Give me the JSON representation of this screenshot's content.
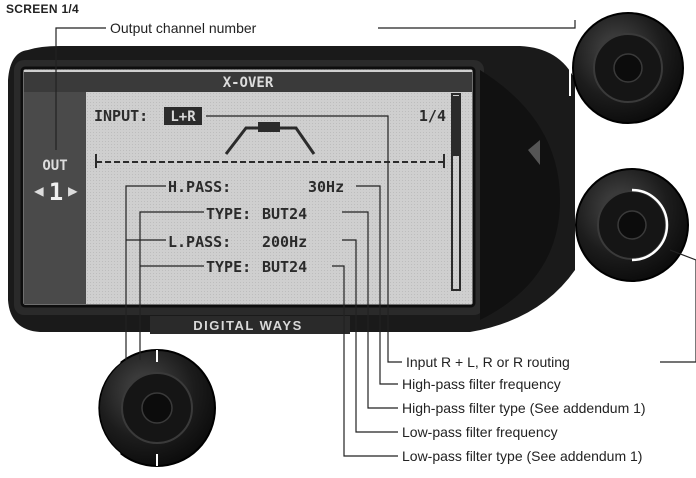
{
  "screen_label": "SCREEN 1/4",
  "lcd": {
    "title": "X-OVER",
    "input_label": "INPUT:",
    "input_value": "L+R",
    "page": "1/4",
    "out_label": "OUT",
    "channel": "1",
    "hpass_label": "H.PASS:",
    "hpass_value": "30Hz",
    "hpass_type_label": "TYPE:",
    "hpass_type_value": "BUT24",
    "lpass_label": "L.PASS:",
    "lpass_value": "200Hz",
    "lpass_type_label": "TYPE:",
    "lpass_type_value": "BUT24"
  },
  "brand": "DIGITAL WAYS",
  "callouts": {
    "output_channel": "Output channel number",
    "input_routing": "Input R + L, R or R routing",
    "hp_freq": "High-pass filter frequency",
    "hp_type": "High-pass filter type (See addendum 1)",
    "lp_freq": "Low-pass filter frequency",
    "lp_type": "Low-pass filter type (See addendum 1)"
  }
}
